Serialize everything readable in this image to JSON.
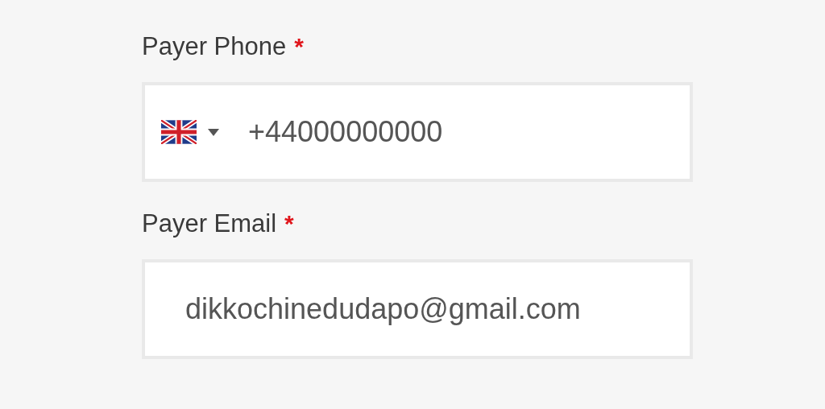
{
  "fields": [
    {
      "kind": "phone",
      "label": "Payer Phone",
      "required_mark": "*",
      "value": "+44000000000"
    },
    {
      "kind": "email",
      "label": "Payer Email",
      "required_mark": "*",
      "value": "dikkochinedudapo@gmail.com"
    }
  ]
}
